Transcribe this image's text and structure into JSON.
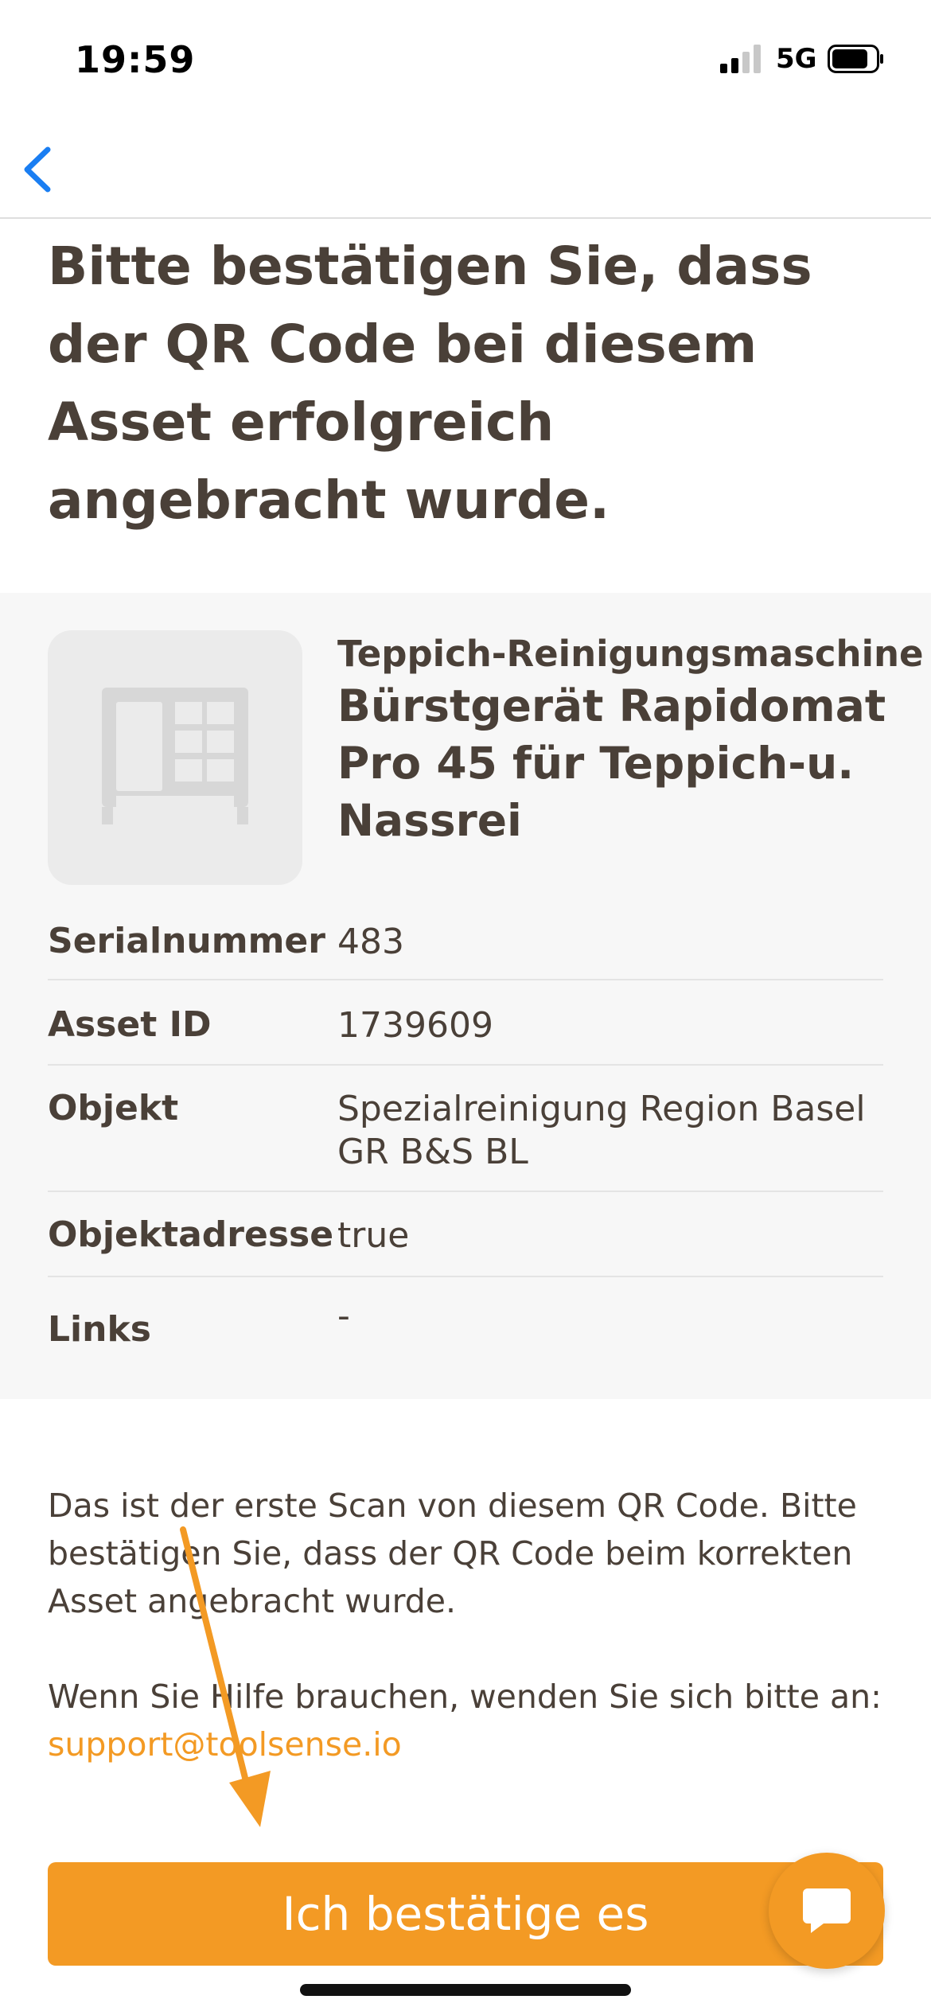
{
  "status_bar": {
    "time": "19:59",
    "network": "5G"
  },
  "title": "Bitte bestätigen Sie, dass der QR Code bei diesem Asset erfolgreich angebracht wurde.",
  "asset": {
    "category": "Teppich-Reinigungsmaschine",
    "name": "Bürstgerät Rapidomat Pro 45 für Teppich-u. Nassrei",
    "details": [
      {
        "label": "Serialnummer",
        "value": "483"
      },
      {
        "label": "Asset ID",
        "value": "1739609"
      },
      {
        "label": "Objekt",
        "value": "Spezialreinigung Region Basel GR B&S BL"
      },
      {
        "label": "Objektadresse",
        "value": "true"
      },
      {
        "label": "Links",
        "value": "-"
      }
    ]
  },
  "info_text": "Das ist der erste Scan von diesem QR Code. Bitte bestätigen Sie, dass der QR Code beim korrekten Asset angebracht wurde.",
  "help_text": "Wenn Sie Hilfe brauchen, wenden Sie sich bitte an:",
  "support_email": "support@toolsense.io",
  "confirm_label": "Ich bestätige es",
  "colors": {
    "accent": "#f39a24",
    "text": "#4a4038",
    "back_icon": "#1a7ef2"
  },
  "icons": {
    "back": "chevron-left-icon",
    "asset_placeholder": "machine-icon",
    "chat": "chat-bubble-icon"
  }
}
